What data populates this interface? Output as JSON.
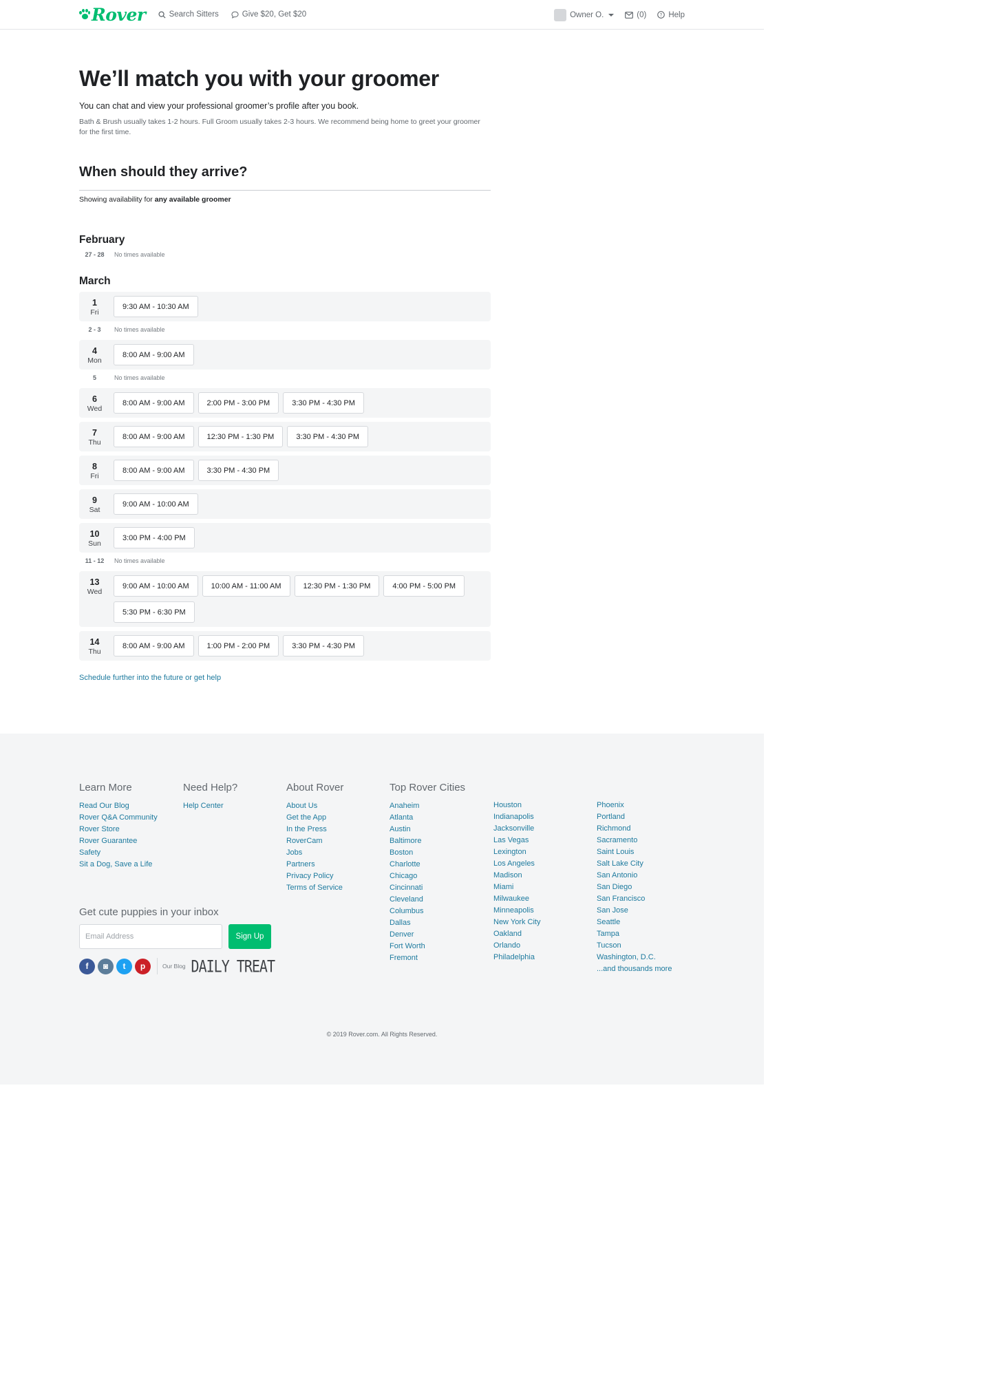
{
  "header": {
    "logo_text": "Rover",
    "search_label": "Search Sitters",
    "referral_label": "Give $20, Get $20",
    "user_label": "Owner O.",
    "messages_label": "(0)",
    "help_label": "Help"
  },
  "hero": {
    "title": "We’ll match you with your groomer",
    "lead": "You can chat and view your professional groomer’s profile after you book.",
    "note": "Bath & Brush usually takes 1-2 hours. Full Groom usually takes 2-3 hours. We recommend being home to greet your groomer for the first time."
  },
  "arrival": {
    "title": "When should they arrive?",
    "availability_prefix": "Showing availability for ",
    "availability_bold": "any available groomer"
  },
  "months": [
    {
      "name": "February",
      "rows": [
        {
          "kind": "none",
          "dates": "27 - 28",
          "text": "No times available"
        }
      ]
    },
    {
      "name": "March",
      "rows": [
        {
          "kind": "day",
          "day": "1",
          "weekday": "Fri",
          "slots": [
            "9:30 AM - 10:30 AM"
          ]
        },
        {
          "kind": "none",
          "dates": "2 - 3",
          "text": "No times available"
        },
        {
          "kind": "day",
          "day": "4",
          "weekday": "Mon",
          "slots": [
            "8:00 AM - 9:00 AM"
          ]
        },
        {
          "kind": "none",
          "dates": "5",
          "text": "No times available"
        },
        {
          "kind": "day",
          "day": "6",
          "weekday": "Wed",
          "slots": [
            "8:00 AM - 9:00 AM",
            "2:00 PM - 3:00 PM",
            "3:30 PM - 4:30 PM"
          ]
        },
        {
          "kind": "day",
          "day": "7",
          "weekday": "Thu",
          "slots": [
            "8:00 AM - 9:00 AM",
            "12:30 PM - 1:30 PM",
            "3:30 PM - 4:30 PM"
          ]
        },
        {
          "kind": "day",
          "day": "8",
          "weekday": "Fri",
          "slots": [
            "8:00 AM - 9:00 AM",
            "3:30 PM - 4:30 PM"
          ]
        },
        {
          "kind": "day",
          "day": "9",
          "weekday": "Sat",
          "slots": [
            "9:00 AM - 10:00 AM"
          ]
        },
        {
          "kind": "day",
          "day": "10",
          "weekday": "Sun",
          "slots": [
            "3:00 PM - 4:00 PM"
          ]
        },
        {
          "kind": "none",
          "dates": "11 - 12",
          "text": "No times available"
        },
        {
          "kind": "day",
          "day": "13",
          "weekday": "Wed",
          "slots": [
            "9:00 AM - 10:00 AM",
            "10:00 AM - 11:00 AM",
            "12:30 PM - 1:30 PM",
            "4:00 PM - 5:00 PM",
            "5:30 PM - 6:30 PM"
          ]
        },
        {
          "kind": "day",
          "day": "14",
          "weekday": "Thu",
          "slots": [
            "8:00 AM - 9:00 AM",
            "1:00 PM - 2:00 PM",
            "3:30 PM - 4:30 PM"
          ]
        }
      ]
    }
  ],
  "future_link": "Schedule further into the future or get help",
  "footer": {
    "learn_more": {
      "title": "Learn More",
      "links": [
        "Read Our Blog",
        "Rover Q&A Community",
        "Rover Store",
        "Rover Guarantee",
        "Safety",
        "Sit a Dog, Save a Life"
      ]
    },
    "need_help": {
      "title": "Need Help?",
      "links": [
        "Help Center"
      ]
    },
    "about": {
      "title": "About Rover",
      "links": [
        "About Us",
        "Get the App",
        "In the Press",
        "RoverCam",
        "Jobs",
        "Partners",
        "Privacy Policy",
        "Terms of Service"
      ]
    },
    "cities": {
      "title": "Top Rover Cities",
      "col1": [
        "Anaheim",
        "Atlanta",
        "Austin",
        "Baltimore",
        "Boston",
        "Charlotte",
        "Chicago",
        "Cincinnati",
        "Cleveland",
        "Columbus",
        "Dallas",
        "Denver",
        "Fort Worth",
        "Fremont"
      ],
      "col2": [
        "Houston",
        "Indianapolis",
        "Jacksonville",
        "Las Vegas",
        "Lexington",
        "Los Angeles",
        "Madison",
        "Miami",
        "Milwaukee",
        "Minneapolis",
        "New York City",
        "Oakland",
        "Orlando",
        "Philadelphia"
      ],
      "col3": [
        "Phoenix",
        "Portland",
        "Richmond",
        "Sacramento",
        "Saint Louis",
        "Salt Lake City",
        "San Antonio",
        "San Diego",
        "San Francisco",
        "San Jose",
        "Seattle",
        "Tampa",
        "Tucson",
        "Washington, D.C.",
        "...and thousands more"
      ]
    },
    "newsletter": {
      "title": "Get cute puppies in your inbox",
      "placeholder": "Email Address",
      "button": "Sign Up"
    },
    "social": [
      {
        "name": "facebook-icon",
        "glyph": "f",
        "color": "#3b5998"
      },
      {
        "name": "instagram-icon",
        "glyph": "◙",
        "color": "#5c7d9a"
      },
      {
        "name": "twitter-icon",
        "glyph": "t",
        "color": "#1da1f2"
      },
      {
        "name": "pinterest-icon",
        "glyph": "p",
        "color": "#cb2027"
      }
    ],
    "our_blog_label": "Our Blog",
    "daily_treat_label": "DAILY TREAT",
    "copyright": "© 2019 Rover.com. All Rights Reserved."
  },
  "colors": {
    "brand_green": "#00bd70",
    "link_blue": "#1d7a9e",
    "row_gray": "#f4f5f6"
  }
}
